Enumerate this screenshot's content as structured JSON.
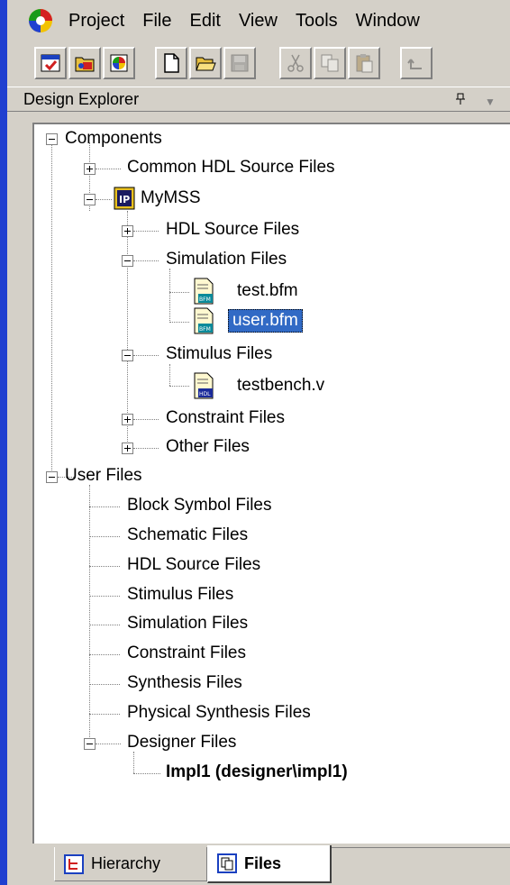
{
  "menu": {
    "items": [
      "Project",
      "File",
      "Edit",
      "View",
      "Tools",
      "Window"
    ]
  },
  "toolbar": {
    "buttons": [
      {
        "icon": "new-project-icon"
      },
      {
        "icon": "open-project-icon"
      },
      {
        "icon": "project-settings-icon"
      },
      {
        "icon": "new-file-icon"
      },
      {
        "icon": "open-file-icon"
      },
      {
        "icon": "save-icon"
      },
      {
        "icon": "cut-icon"
      },
      {
        "icon": "copy-icon"
      },
      {
        "icon": "paste-icon"
      },
      {
        "icon": "undo-icon"
      }
    ]
  },
  "panel": {
    "title": "Design Explorer"
  },
  "tree": {
    "components": "Components",
    "common_hdl": "Common HDL Source Files",
    "mymss": "MyMSS",
    "hdl_source": "HDL Source Files",
    "simulation_files": "Simulation Files",
    "test_bfm": "test.bfm",
    "user_bfm": "user.bfm",
    "stimulus_files": "Stimulus Files",
    "testbench_v": "testbench.v",
    "constraint_files": "Constraint Files",
    "other_files": "Other Files",
    "user_files": "User Files",
    "uf_block_symbol": "Block Symbol Files",
    "uf_schematic": "Schematic Files",
    "uf_hdl_source": "HDL Source Files",
    "uf_stimulus": "Stimulus Files",
    "uf_simulation": "Simulation Files",
    "uf_constraint": "Constraint Files",
    "uf_synthesis": "Synthesis Files",
    "uf_physical_synthesis": "Physical Synthesis Files",
    "uf_designer": "Designer Files",
    "impl1": "Impl1 (designer\\impl1)"
  },
  "tabs": {
    "hierarchy": "Hierarchy",
    "files": "Files"
  },
  "colors": {
    "selection": "#316ac5",
    "border_accent": "#1f3fd0"
  }
}
